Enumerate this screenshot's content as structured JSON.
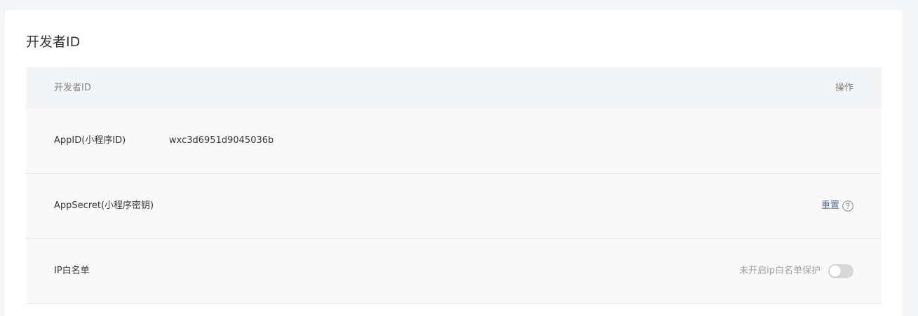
{
  "card": {
    "title": "开发者ID"
  },
  "table": {
    "headers": {
      "left": "开发者ID",
      "right": "操作"
    },
    "rows": [
      {
        "label": "AppID(小程序ID)",
        "value": "wxc3d6951d9045036b"
      },
      {
        "label": "AppSecret(小程序密钥)",
        "action_label": "重置",
        "action_icon": "help-circle-icon"
      },
      {
        "label": "IP白名单",
        "hint": "未开启ip白名单保护",
        "toggle_on": false
      }
    ]
  },
  "colors": {
    "link": "#576b95",
    "header_bg": "#f3f4f5",
    "row_bg": "#f9f9f9",
    "toggle_off": "#d8d8d8"
  }
}
